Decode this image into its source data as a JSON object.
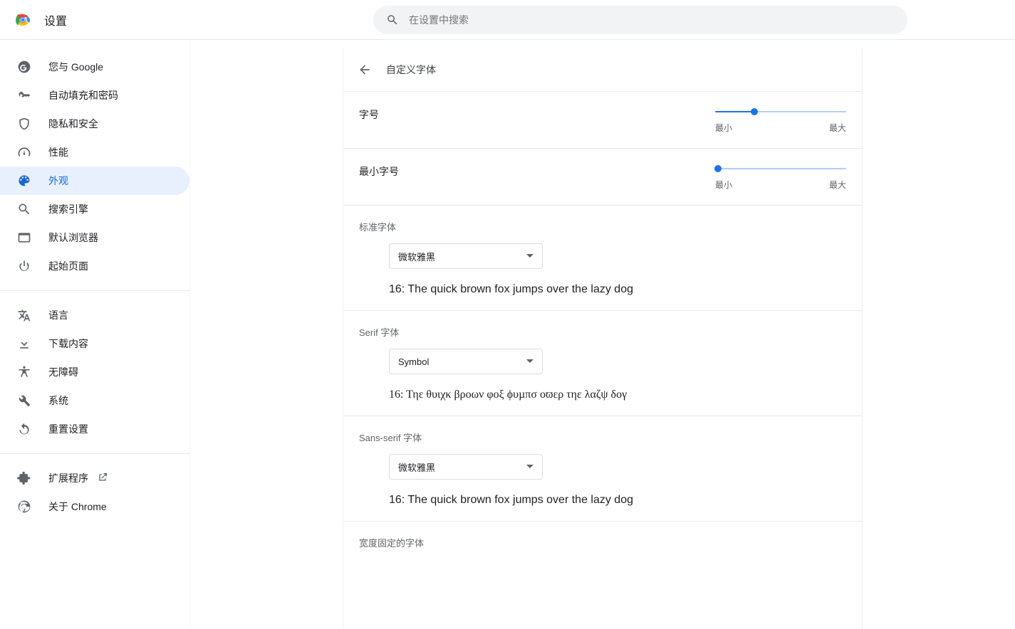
{
  "header": {
    "title": "设置",
    "search_placeholder": "在设置中搜索"
  },
  "sidebar": {
    "items": [
      {
        "id": "you-google",
        "label": "您与 Google",
        "icon": "google"
      },
      {
        "id": "autofill",
        "label": "自动填充和密码",
        "icon": "key"
      },
      {
        "id": "privacy",
        "label": "隐私和安全",
        "icon": "shield"
      },
      {
        "id": "performance",
        "label": "性能",
        "icon": "speed"
      },
      {
        "id": "appearance",
        "label": "外观",
        "icon": "palette",
        "active": true
      },
      {
        "id": "search-engine",
        "label": "搜索引擎",
        "icon": "search"
      },
      {
        "id": "default-browser",
        "label": "默认浏览器",
        "icon": "browser"
      },
      {
        "id": "on-startup",
        "label": "起始页面",
        "icon": "power"
      }
    ],
    "items2": [
      {
        "id": "languages",
        "label": "语言",
        "icon": "translate"
      },
      {
        "id": "downloads",
        "label": "下载内容",
        "icon": "download"
      },
      {
        "id": "accessibility",
        "label": "无障碍",
        "icon": "accessibility"
      },
      {
        "id": "system",
        "label": "系统",
        "icon": "wrench"
      },
      {
        "id": "reset",
        "label": "重置设置",
        "icon": "reset"
      }
    ],
    "items3": [
      {
        "id": "extensions",
        "label": "扩展程序",
        "icon": "extension",
        "external": true
      },
      {
        "id": "about",
        "label": "关于 Chrome",
        "icon": "chrome"
      }
    ]
  },
  "page": {
    "title": "自定义字体",
    "sliders": {
      "font_size": {
        "label": "字号",
        "min_label": "最小",
        "max_label": "最大",
        "percent": 30
      },
      "min_font_size": {
        "label": "最小字号",
        "min_label": "最小",
        "max_label": "最大",
        "percent": 2
      }
    },
    "fonts": {
      "standard": {
        "label": "标准字体",
        "value": "微软雅黑",
        "preview": "16: The quick brown fox jumps over the lazy dog"
      },
      "serif": {
        "label": "Serif 字体",
        "value": "Symbol",
        "preview": "16: Τηε θυιχκ βροων φοξ ϕυµπσ οϖερ τηε λαζψ δογ"
      },
      "sans_serif": {
        "label": "Sans-serif 字体",
        "value": "微软雅黑",
        "preview": "16: The quick brown fox jumps over the lazy dog"
      },
      "fixed": {
        "label": "宽度固定的字体"
      }
    }
  }
}
